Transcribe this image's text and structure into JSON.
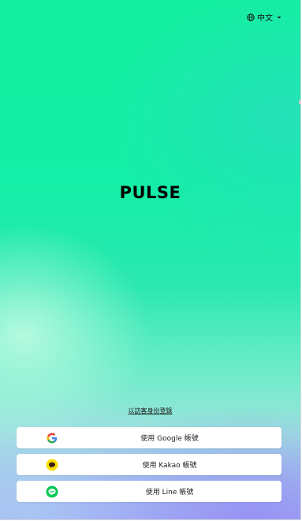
{
  "language": {
    "label": "中文"
  },
  "app": {
    "name": "PULSE"
  },
  "guest_link": "以訪客身份登錄",
  "login_buttons": [
    {
      "provider": "google",
      "label": "使用 Google 帳號",
      "icon": "google-icon"
    },
    {
      "provider": "kakao",
      "label": "使用 Kakao 帳號",
      "icon": "kakao-icon"
    },
    {
      "provider": "line",
      "label": "使用 Line 帳號",
      "icon": "line-icon"
    }
  ],
  "colors": {
    "top_gradient": "#13efa0",
    "bottom_gradient": "#a8b8f0",
    "kakao_yellow": "#f9e000",
    "line_green": "#06c755"
  }
}
